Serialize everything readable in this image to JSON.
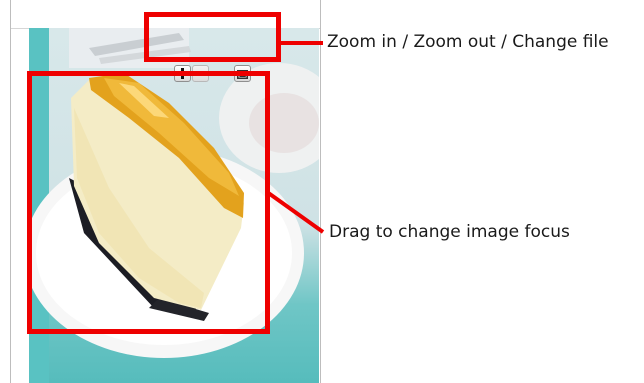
{
  "toolbar": {
    "zoom_in_icon": "plus-icon",
    "zoom_out_icon": "minus-icon",
    "change_file_icon": "folder-image-icon",
    "zoom_out_enabled": false
  },
  "annotations": {
    "toolbar_callout": "Zoom in / Zoom out / Change file",
    "image_callout": "Drag to change image focus",
    "highlight_color": "#ee0000"
  },
  "photo": {
    "subject": "slice of cheesecake with caramel topping on white plate",
    "background_accent": "#56bcbc"
  }
}
